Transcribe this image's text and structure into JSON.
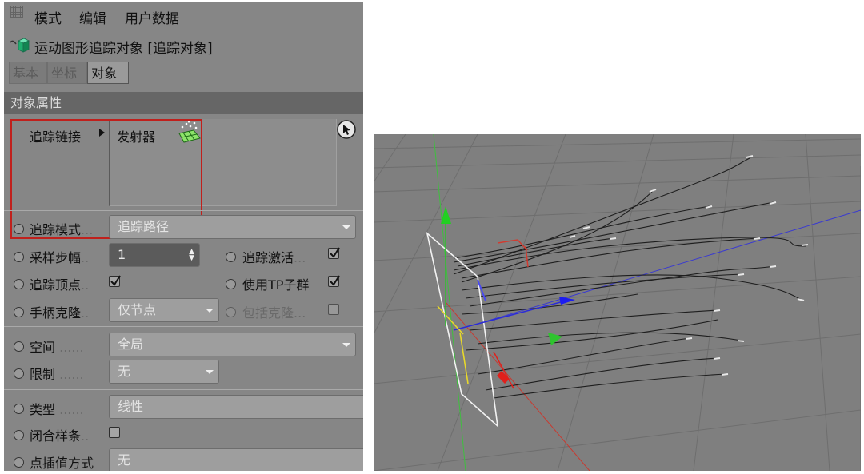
{
  "menu": {
    "mode": "模式",
    "edit": "编辑",
    "userdata": "用户数据"
  },
  "object": {
    "title": "运动图形追踪对象 [追踪对象]",
    "icon": "cube-icon"
  },
  "tabs": [
    {
      "label": "基本"
    },
    {
      "label": "坐标"
    },
    {
      "label": "对象",
      "active": true
    }
  ],
  "section": {
    "title": "对象属性"
  },
  "trace_link": {
    "label": "追踪链接",
    "item": "发射器",
    "item_icon": "emitter-icon"
  },
  "fields": {
    "trace_mode": {
      "label": "追踪模式",
      "dots": "...",
      "value": "追踪路径"
    },
    "sampling": {
      "label": "采样步幅",
      "dots": "..",
      "value": "1"
    },
    "trace_active": {
      "label": "追踪激活",
      "dots": "...",
      "checked": true
    },
    "trace_vertices": {
      "label": "追踪顶点",
      "dots": "..",
      "checked": true
    },
    "use_tp": {
      "label": "使用TP子群",
      "checked": true
    },
    "handle_clone": {
      "label": "手柄克隆",
      "dots": "..",
      "value": "仅节点"
    },
    "include_clone": {
      "label": "包括克隆",
      "dots": "...",
      "checked": false
    },
    "space": {
      "label": "空间",
      "dots": "......",
      "value": "全局"
    },
    "limit": {
      "label": "限制",
      "dots": "......",
      "value": "无"
    },
    "type": {
      "label": "类型",
      "dots": "......",
      "value": "线性"
    },
    "close_spline": {
      "label": "闭合样条",
      "dots": "..",
      "checked": false
    },
    "interp": {
      "label": "点插值方式",
      "value": "无"
    }
  },
  "colors": {
    "panel_bg": "#868686",
    "section_bg": "#666666",
    "viewport_bg": "#7f7f7f",
    "highlight": "#c0201c",
    "axis_x": "#e0201c",
    "axis_y": "#2ec42e",
    "axis_z": "#2b2bd8"
  }
}
